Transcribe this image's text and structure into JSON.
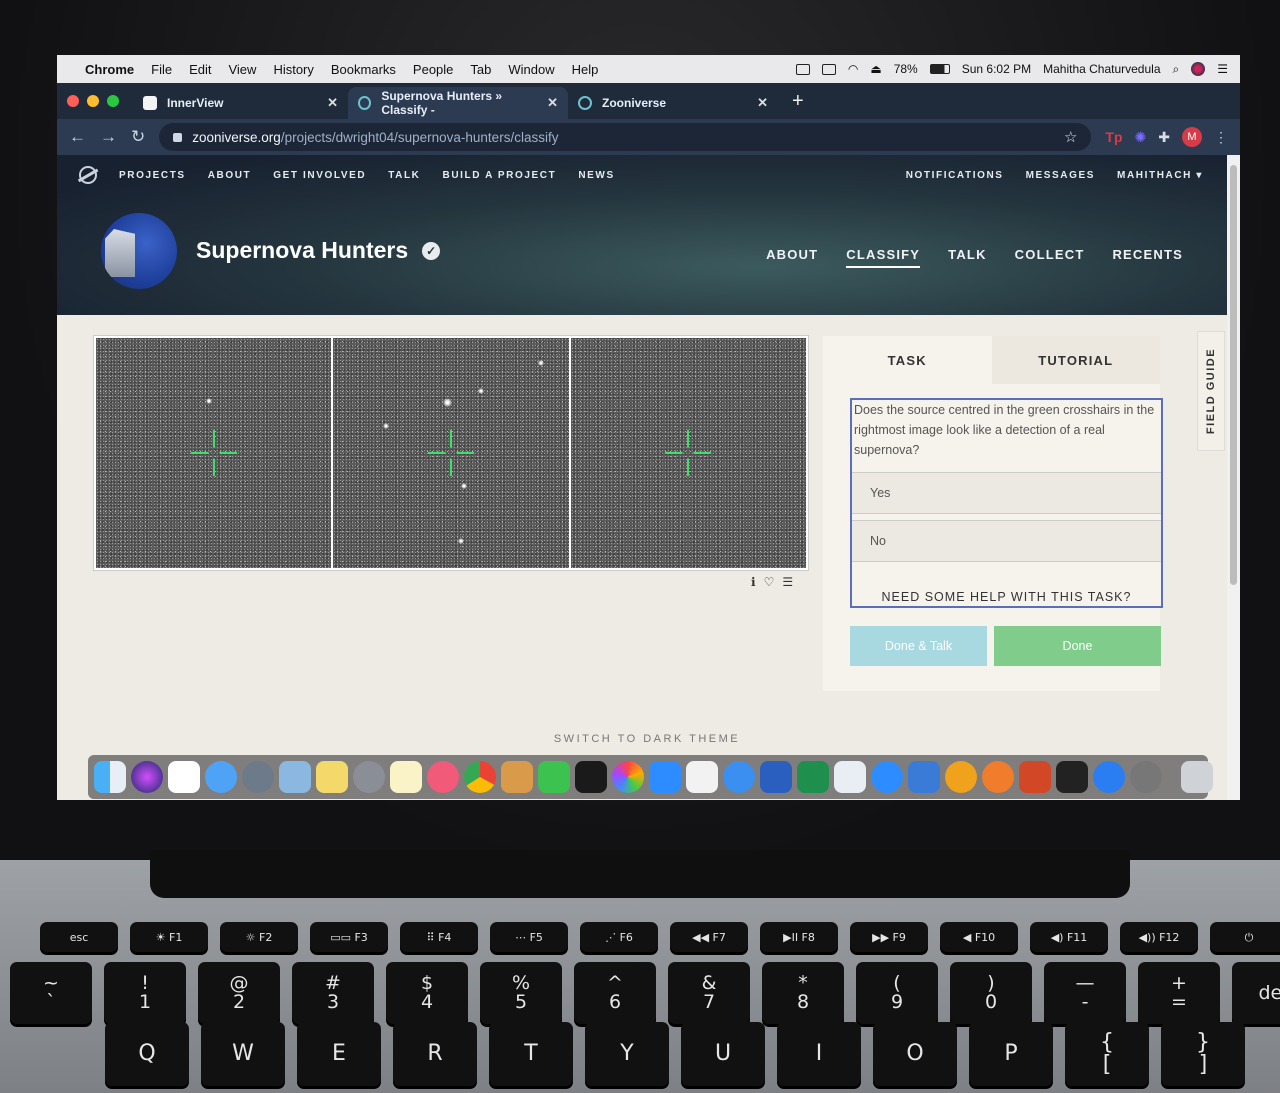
{
  "menubar": {
    "app": "Chrome",
    "menus": [
      "File",
      "Edit",
      "View",
      "History",
      "Bookmarks",
      "People",
      "Tab",
      "Window",
      "Help"
    ],
    "battery": "78%",
    "clock": "Sun 6:02 PM",
    "user": "Mahitha Chaturvedula"
  },
  "tabs": [
    {
      "title": "InnerView",
      "close": "✕"
    },
    {
      "title": "Supernova Hunters » Classify -",
      "close": "✕"
    },
    {
      "title": "Zooniverse",
      "close": "✕"
    }
  ],
  "new_tab": "+",
  "address": {
    "host": "zooniverse.org",
    "path": "/projects/dwright04/supernova-hunters/classify"
  },
  "extensions": {
    "tp": "Tp",
    "profile_letter": "M"
  },
  "zoo_nav": {
    "left": [
      "PROJECTS",
      "ABOUT",
      "GET INVOLVED",
      "TALK",
      "BUILD A PROJECT",
      "NEWS"
    ],
    "right": [
      "NOTIFICATIONS",
      "MESSAGES",
      "MAHITHACH ▾"
    ]
  },
  "project": {
    "title": "Supernova Hunters",
    "nav": [
      "ABOUT",
      "CLASSIFY",
      "TALK",
      "COLLECT",
      "RECENTS"
    ],
    "active_nav": "CLASSIFY"
  },
  "task": {
    "tabs": [
      "TASK",
      "TUTORIAL"
    ],
    "question": "Does the source centred in the green crosshairs in the rightmost image look like a detection of a real supernova?",
    "answers": [
      "Yes",
      "No"
    ],
    "help": "NEED SOME HELP WITH THIS TASK?",
    "done_talk": "Done & Talk",
    "done": "Done"
  },
  "field_guide": "FIELD GUIDE",
  "theme_switch": "SWITCH TO DARK THEME",
  "keyboard": {
    "frow": [
      "esc",
      "☀ F1",
      "☼ F2",
      "▭▭ F3",
      "⠿ F4",
      "⋯ F5",
      "⋰ F6",
      "◀◀ F7",
      "▶II F8",
      "▶▶ F9",
      "◀ F10",
      "◀) F11",
      "◀)) F12",
      "⏻"
    ],
    "nrow": [
      "~\n`",
      "!\n1",
      "@\n2",
      "#\n3",
      "$\n4",
      "%\n5",
      "^\n6",
      "&\n7",
      "*\n8",
      "(\n9",
      ")\n0",
      "—\n-",
      "+\n=",
      "del"
    ],
    "qrow": [
      "Q",
      "W",
      "E",
      "R",
      "T",
      "Y",
      "U",
      "I",
      "O",
      "P",
      "{\n[",
      "}\n]"
    ]
  },
  "colors": {
    "crosshair": "#3fe06a",
    "done": "#7fcc8b",
    "done_talk": "#a8d8e0",
    "question_border": "#5b6fb8"
  }
}
